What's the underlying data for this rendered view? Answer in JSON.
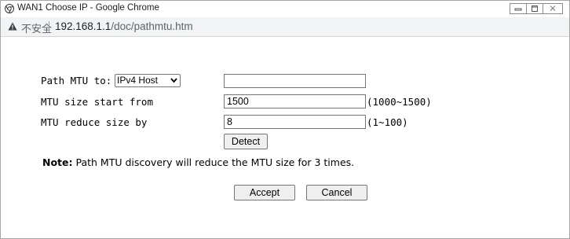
{
  "window": {
    "title": "WAN1 Choose IP - Google Chrome"
  },
  "address_bar": {
    "security_label": "不安全",
    "url_host": "192.168.1.1",
    "url_path": "/doc/pathmtu.htm"
  },
  "form": {
    "path_mtu_label": "Path MTU to:",
    "path_mtu_target_selected": "IPv4 Host",
    "path_mtu_target_value": "",
    "mtu_start_label": "MTU size start from",
    "mtu_start_value": "1500",
    "mtu_start_range": "(1000~1500)",
    "mtu_reduce_label": "MTU reduce size by",
    "mtu_reduce_value": "8",
    "mtu_reduce_range": "(1~100)",
    "detect_button": "Detect",
    "note_prefix": "Note:",
    "note_text": "Path MTU discovery will reduce the MTU size for 3 times.",
    "accept_button": "Accept",
    "cancel_button": "Cancel"
  },
  "icons": {
    "browser": "chrome-icon",
    "security": "warning-triangle-icon",
    "minimize": "minimize-icon",
    "maximize": "maximize-icon",
    "close": "close-icon",
    "dropdown": "chevron-down-icon"
  }
}
